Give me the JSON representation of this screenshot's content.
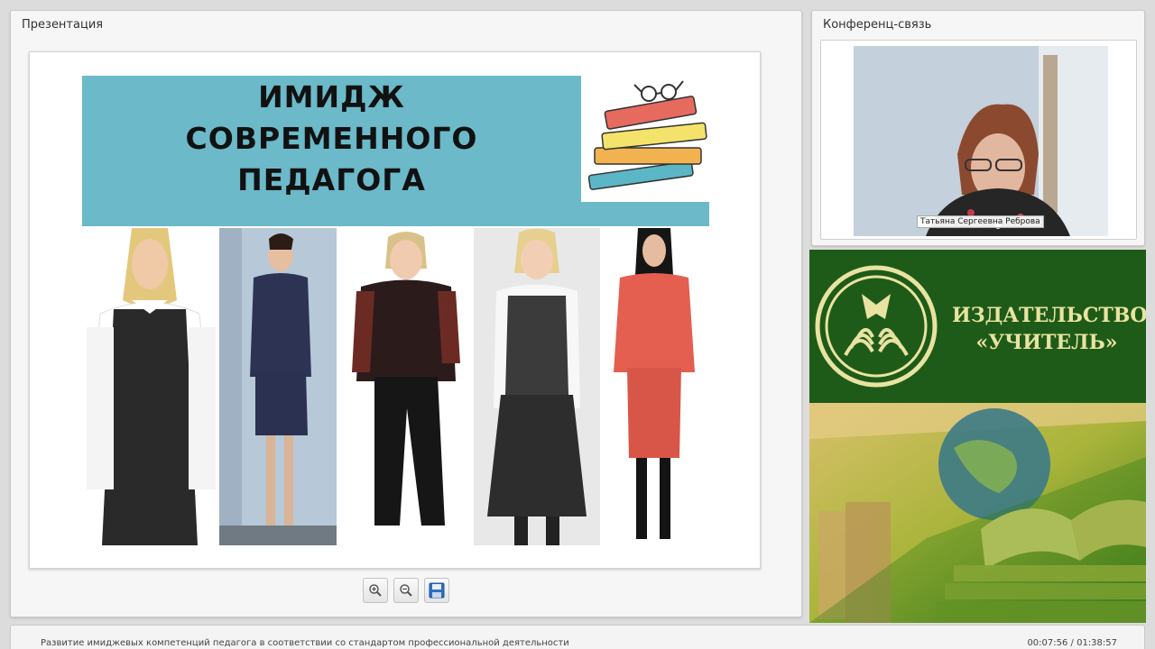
{
  "presentation": {
    "title": "Презентация",
    "slide": {
      "title_lines": [
        "ИМИДЖ",
        "СОВРЕМЕННОГО",
        "ПЕДАГОГА"
      ]
    },
    "toolbar": {
      "zoom_in_icon": "zoom-in-icon",
      "zoom_out_icon": "zoom-out-icon",
      "save_icon": "save-icon"
    }
  },
  "conference": {
    "title": "Конференц-связь",
    "participant_name": "Татьяна Сергеевна Реброва"
  },
  "publisher": {
    "name_lines": [
      "ИЗДАТЕЛЬСТВО",
      "«УЧИТЕЛЬ»"
    ]
  },
  "footer": {
    "webinar_title": "Развитие имиджевых компетенций педагога в соответствии со стандартом профессиональной деятельности",
    "time": "00:07:56 / 01:38:57"
  },
  "colors": {
    "banner": "#6bb9c9",
    "publisher_green": "#1f5b18",
    "publisher_text": "#e9e3a2"
  }
}
